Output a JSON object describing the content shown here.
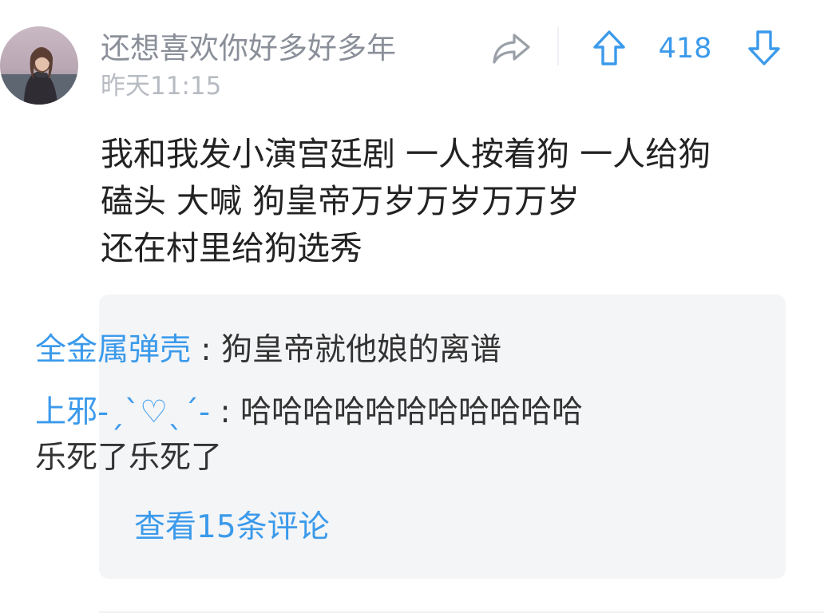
{
  "comment": {
    "author": "还想喜欢你好多好多年",
    "timestamp": "昨天11:15",
    "vote_count": "418",
    "body_lines": [
      "我和我发小演宫廷剧 一人按着狗 一人给狗",
      "磕头 大喊 狗皇帝万岁万岁万万岁",
      "还在村里给狗选秀"
    ],
    "icons": {
      "share": "share-arrow-icon",
      "upvote": "arrow-up-icon",
      "downvote": "arrow-down-icon"
    }
  },
  "replies": {
    "items": [
      {
        "author": "全金属弹壳",
        "separator": " : ",
        "text": "狗皇帝就他娘的离谱",
        "text_line2": ""
      },
      {
        "author": "上邪-ˏˋ♡ˎˊ-",
        "separator": " : ",
        "text": "哈哈哈哈哈哈哈哈哈哈哈",
        "text_line2": "乐死了乐死了"
      }
    ],
    "view_more_label": "查看15条评论"
  },
  "colors": {
    "accent": "#3b9aeb",
    "username": "#8a8f99",
    "timestamp": "#b7bbc2",
    "body_text": "#222222",
    "reply_bg": "#f4f5f7"
  }
}
